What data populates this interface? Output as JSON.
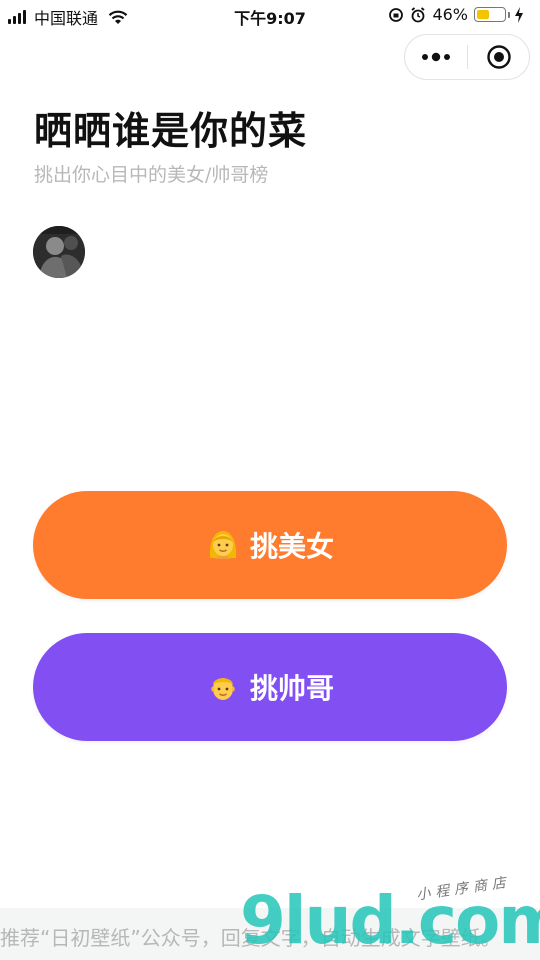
{
  "status_bar": {
    "carrier": "中国联通",
    "time": "下午9:07",
    "battery_percent": "46%",
    "battery_level": 0.46
  },
  "capsule": {
    "more_icon": "more-dots-icon",
    "close_icon": "target-close-icon"
  },
  "header": {
    "title": "晒晒谁是你的菜",
    "subtitle": "挑出你心目中的美女/帅哥榜"
  },
  "buttons": {
    "girl": {
      "label": "挑美女",
      "icon": "woman-emoji-icon",
      "color": "#ff7b2e"
    },
    "boy": {
      "label": "挑帅哥",
      "icon": "man-emoji-icon",
      "color": "#824ff3"
    }
  },
  "footer": {
    "text": "推荐“日初壁纸”公众号，回复文字，自动生成文字壁纸。"
  },
  "watermark": {
    "main": "9lud.com",
    "sub": "小程序商店"
  }
}
